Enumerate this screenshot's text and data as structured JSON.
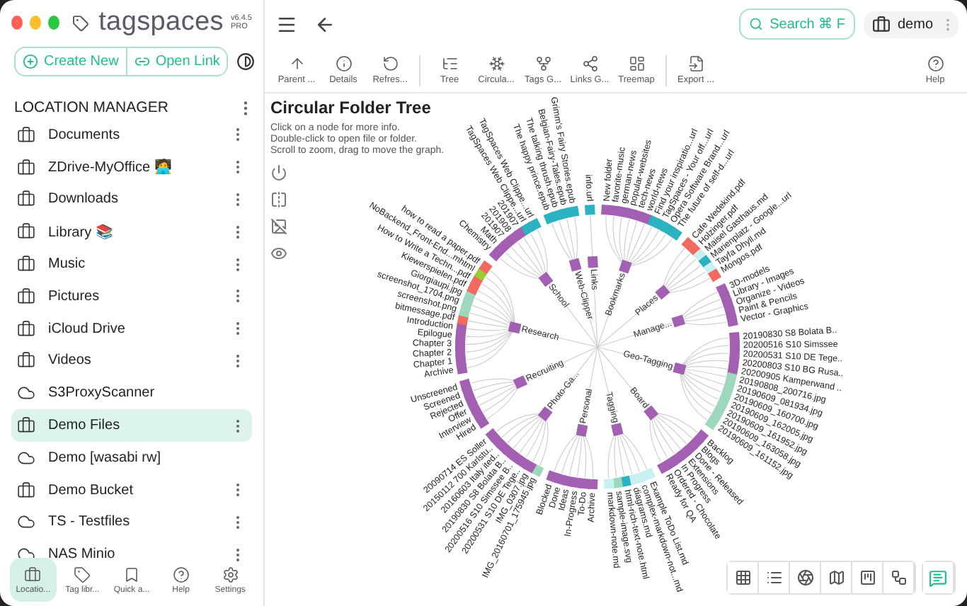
{
  "app": {
    "brand": "tagspaces",
    "version": "v6.4.5",
    "edition": "PRO"
  },
  "sidebar": {
    "actions": [
      {
        "kind": "create",
        "label": "Create New"
      },
      {
        "kind": "link",
        "label": "Open Link"
      }
    ],
    "heading": "LOCATION MANAGER",
    "locations": [
      {
        "name": "Documents",
        "kind": "local",
        "menu": true,
        "selected": false
      },
      {
        "name": "ZDrive-MyOffice 🧑‍💻",
        "kind": "local",
        "menu": true,
        "selected": false
      },
      {
        "name": "Downloads",
        "kind": "local",
        "menu": true,
        "selected": false
      },
      {
        "name": "Library 📚",
        "kind": "local",
        "menu": true,
        "selected": false
      },
      {
        "name": "Music",
        "kind": "local",
        "menu": true,
        "selected": false
      },
      {
        "name": "Pictures",
        "kind": "local",
        "menu": true,
        "selected": false
      },
      {
        "name": "iCloud Drive",
        "kind": "local",
        "menu": true,
        "selected": false
      },
      {
        "name": "Videos",
        "kind": "local",
        "menu": true,
        "selected": false
      },
      {
        "name": "S3ProxyScanner",
        "kind": "cloud",
        "menu": false,
        "selected": false
      },
      {
        "name": "Demo Files",
        "kind": "local",
        "menu": true,
        "selected": true
      },
      {
        "name": "Demo [wasabi rw]",
        "kind": "cloud",
        "menu": false,
        "selected": false
      },
      {
        "name": "Demo Bucket",
        "kind": "local",
        "menu": true,
        "selected": false
      },
      {
        "name": "TS - Testfiles",
        "kind": "cloud",
        "menu": true,
        "selected": false
      },
      {
        "name": "NAS Minio",
        "kind": "cloud",
        "menu": true,
        "selected": false
      }
    ],
    "nav": [
      {
        "kind": "locations",
        "label": "Locatio...",
        "selected": true
      },
      {
        "kind": "tags",
        "label": "Tag libr...",
        "selected": false
      },
      {
        "kind": "quick",
        "label": "Quick a...",
        "selected": false
      },
      {
        "kind": "help",
        "label": "Help",
        "selected": false
      },
      {
        "kind": "settings",
        "label": "Settings",
        "selected": false
      }
    ]
  },
  "topbar": {
    "search": {
      "label": "Search",
      "shortcut": "⌘ F"
    },
    "location": "demo"
  },
  "toolbar": {
    "groups": [
      [
        {
          "kind": "parent",
          "label": "Parent ..."
        },
        {
          "kind": "details",
          "label": "Details"
        },
        {
          "kind": "refresh",
          "label": "Refres..."
        }
      ],
      [
        {
          "kind": "tree",
          "label": "Tree"
        },
        {
          "kind": "circular",
          "label": "Circula..."
        },
        {
          "kind": "tags",
          "label": "Tags G..."
        },
        {
          "kind": "links",
          "label": "Links G..."
        },
        {
          "kind": "treemap",
          "label": "Treemap"
        }
      ],
      [
        {
          "kind": "export",
          "label": "Export ..."
        }
      ]
    ],
    "help": {
      "kind": "help",
      "label": "Help"
    }
  },
  "view": {
    "title": "Circular Folder Tree",
    "hints": [
      "Click on a node for more info.",
      "Double-click to open file or folder.",
      "Scroll to zoom, drag to move the graph."
    ],
    "tree": [
      {
        "label": "Geo-Tagging",
        "leaves": [
          {
            "label": "20190830 S8 Bolata B..",
            "color": "#a35fb1"
          },
          {
            "label": "20200516 S10 Simssee",
            "color": "#a35fb1"
          },
          {
            "label": "20200531 S10 DE Tege..",
            "color": "#a35fb1"
          },
          {
            "label": "20200803 S10 BG Rusa..",
            "color": "#a35fb1"
          },
          {
            "label": "20200905 Kamperwand ..",
            "color": "#a35fb1"
          },
          {
            "label": "20190808_200716.jpg",
            "color": "#9dd8bc"
          },
          {
            "label": "20190609_081934.jpg",
            "color": "#9dd8bc"
          },
          {
            "label": "20190609_160700.jpg",
            "color": "#9dd8bc"
          },
          {
            "label": "20190609_162005.jpg",
            "color": "#9dd8bc"
          },
          {
            "label": "20190609_161952.jpg",
            "color": "#9dd8bc"
          },
          {
            "label": "20190609_163058.jpg",
            "color": "#9dd8bc"
          },
          {
            "label": "20190609_161152.jpg",
            "color": "#9dd8bc"
          }
        ]
      },
      {
        "label": "Board",
        "leaves": [
          {
            "label": "Backlog",
            "color": "#a35fb1"
          },
          {
            "label": "Blogs",
            "color": "#a35fb1"
          },
          {
            "label": "Done - Released",
            "color": "#a35fb1"
          },
          {
            "label": "Extensions",
            "color": "#a35fb1"
          },
          {
            "label": "In Progress",
            "color": "#a35fb1"
          },
          {
            "label": "Ordered - Chocolate",
            "color": "#a35fb1"
          },
          {
            "label": "Ready for QA",
            "color": "#a35fb1"
          }
        ]
      },
      {
        "label": "Tagging",
        "leaves": [
          {
            "label": "Example ToDo List.md",
            "color": "#c8f0f0"
          },
          {
            "label": "complex-markdown-not...md",
            "color": "#c8f0f0"
          },
          {
            "label": "diagrams.md",
            "color": "#c8f0f0"
          },
          {
            "label": "html-rich-text-note.html",
            "color": "#2bb3c2"
          },
          {
            "label": "sample-image.svg",
            "color": "#9dd8bc"
          },
          {
            "label": "markdown-note.md",
            "color": "#c8f0f0"
          }
        ]
      },
      {
        "label": "Personal",
        "leaves": [
          {
            "label": "Archive",
            "color": "#a35fb1"
          },
          {
            "label": "To-Do",
            "color": "#a35fb1"
          },
          {
            "label": "In-Progress",
            "color": "#a35fb1"
          },
          {
            "label": "Ideas",
            "color": "#a35fb1"
          },
          {
            "label": "Done",
            "color": "#a35fb1"
          },
          {
            "label": "Blocked",
            "color": "#a35fb1"
          }
        ]
      },
      {
        "label": "Photo-Ga...",
        "leaves": [
          {
            "label": "IMG_20160701_175945.jpg",
            "color": "#9dd8bc"
          },
          {
            "label": "IMG_0307.jpg",
            "color": "#a35fb1"
          },
          {
            "label": "20200531 S10 DE Tege..",
            "color": "#a35fb1"
          },
          {
            "label": "20200516 S10 Simssee B..",
            "color": "#a35fb1"
          },
          {
            "label": "20190830 S8 Bolata B..",
            "color": "#a35fb1"
          },
          {
            "label": "20160603 Italy ited..",
            "color": "#a35fb1"
          },
          {
            "label": "20150112 700 Karlstu..",
            "color": "#a35fb1"
          },
          {
            "label": "20090714 ES Soller",
            "color": "#a35fb1"
          }
        ]
      },
      {
        "label": "Recruiting",
        "leaves": [
          {
            "label": "Hired",
            "color": "#a35fb1"
          },
          {
            "label": "Interview",
            "color": "#a35fb1"
          },
          {
            "label": "Offer",
            "color": "#a35fb1"
          },
          {
            "label": "Rejected",
            "color": "#a35fb1"
          },
          {
            "label": "Screened",
            "color": "#a35fb1"
          },
          {
            "label": "Unscreened",
            "color": "#a35fb1"
          }
        ]
      },
      {
        "label": "Research",
        "leaves": [
          {
            "label": "Archive",
            "color": "#a35fb1"
          },
          {
            "label": "Chapter 1",
            "color": "#a35fb1"
          },
          {
            "label": "Chapter 2",
            "color": "#a35fb1"
          },
          {
            "label": "Chapter 3",
            "color": "#a35fb1"
          },
          {
            "label": "Epilogue",
            "color": "#a35fb1"
          },
          {
            "label": "Introduction",
            "color": "#a35fb1"
          },
          {
            "label": "bitmessage.pdf",
            "color": "#f26a5f"
          },
          {
            "label": "screenshot.png",
            "color": "#9dd8bc"
          },
          {
            "label": "screenshot_1704.png",
            "color": "#9dd8bc"
          },
          {
            "label": "Giorgiaupi.jpg",
            "color": "#9dd8bc"
          },
          {
            "label": "Kiewerspielen.pdf",
            "color": "#f26a5f"
          },
          {
            "label": "How to Write a Techn...pdf",
            "color": "#f26a5f"
          },
          {
            "label": "NoBackend_Front-End...mhtml",
            "color": "#9acd32"
          },
          {
            "label": "how to read a paper.pdf",
            "color": "#f26a5f"
          }
        ]
      },
      {
        "label": "School",
        "leaves": [
          {
            "label": "Chemistry",
            "color": "#a35fb1"
          },
          {
            "label": "Math",
            "color": "#a35fb1"
          },
          {
            "label": "201907",
            "color": "#a35fb1"
          },
          {
            "label": "201908",
            "color": "#a35fb1"
          },
          {
            "label": "201907",
            "color": "#a35fb1"
          },
          {
            "label": "TagSpaces Web Clippe...url",
            "color": "#2bb3c2"
          },
          {
            "label": "TagSpaces Web Clippe...url",
            "color": "#2bb3c2"
          }
        ]
      },
      {
        "label": "Web-Clipper",
        "leaves": [
          {
            "label": "The happy prince.epub",
            "color": "#2bb3c2"
          },
          {
            "label": "The talking thrush.epub",
            "color": "#2bb3c2"
          },
          {
            "label": "Belgian-Fairy-Tales.epub",
            "color": "#2bb3c2"
          },
          {
            "label": "Grimm's Fairy Stories.epub",
            "color": "#2bb3c2"
          }
        ]
      },
      {
        "label": "Links",
        "leaves": [
          {
            "label": "info.url",
            "color": "#2bb3c2"
          }
        ]
      },
      {
        "label": "Bookmarks",
        "leaves": [
          {
            "label": "New folder",
            "color": "#a35fb1"
          },
          {
            "label": "favorite-music",
            "color": "#a35fb1"
          },
          {
            "label": "german-news",
            "color": "#a35fb1"
          },
          {
            "label": "popular-websites",
            "color": "#a35fb1"
          },
          {
            "label": "tech-news",
            "color": "#a35fb1"
          },
          {
            "label": "world-news",
            "color": "#a35fb1"
          },
          {
            "label": "Find your inspiratio...url",
            "color": "#2bb3c2"
          },
          {
            "label": "TagSpaces - Your off...url",
            "color": "#2bb3c2"
          },
          {
            "label": "Opera Software Brand...url",
            "color": "#2bb3c2"
          },
          {
            "label": "The future of self-d...url",
            "color": "#2bb3c2"
          }
        ]
      },
      {
        "label": "Places",
        "leaves": [
          {
            "label": "Cafe Wedekind.pdf",
            "color": "#f26a5f"
          },
          {
            "label": "Holzinger.pdf",
            "color": "#f26a5f"
          },
          {
            "label": "Maisel Gasthaus.md",
            "color": "#c8f0f0"
          },
          {
            "label": "Marienplatz - Google...url",
            "color": "#2bb3c2"
          },
          {
            "label": "Tayfa Dhyll.md",
            "color": "#c8f0f0"
          },
          {
            "label": "Mongos.pdf",
            "color": "#f26a5f"
          }
        ]
      },
      {
        "label": "Manage...",
        "leaves": [
          {
            "label": "3D-models",
            "color": "#a35fb1"
          },
          {
            "label": "Library - Images",
            "color": "#a35fb1"
          },
          {
            "label": "Organize - Videos",
            "color": "#a35fb1"
          },
          {
            "label": "Paint & Pencils",
            "color": "#a35fb1"
          },
          {
            "label": "Vector - Graphics",
            "color": "#a35fb1"
          }
        ]
      }
    ]
  }
}
